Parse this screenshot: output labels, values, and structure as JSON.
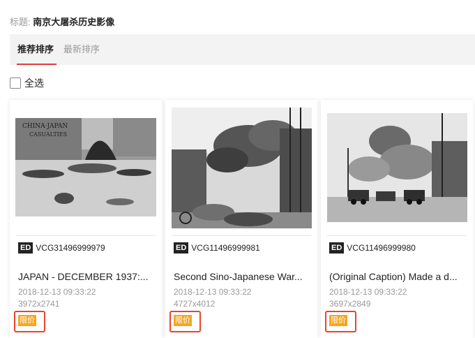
{
  "header": {
    "title_prefix": "标题:",
    "title": "南京大屠杀历史影像"
  },
  "tabs": [
    {
      "label": "推荐排序",
      "active": true
    },
    {
      "label": "最新排序",
      "active": false
    }
  ],
  "select_all": {
    "label": "全选",
    "checked": false
  },
  "colors": {
    "accent_red": "#e4393c",
    "price_orange": "#f5a623",
    "highlight_red": "#e8452c"
  },
  "cards": [
    {
      "badge": "ED",
      "id": "VCG31496999979",
      "caption": "JAPAN - DECEMBER 1937:...",
      "date": "2018-12-13 09:33:22",
      "dims": "3972x2741",
      "price_label": "限价"
    },
    {
      "badge": "ED",
      "id": "VCG11496999981",
      "caption": "Second Sino-Japanese War...",
      "date": "2018-12-13 09:33:22",
      "dims": "4727x4012",
      "price_label": "限价"
    },
    {
      "badge": "ED",
      "id": "VCG11496999980",
      "caption": "(Original Caption) Made a d...",
      "date": "2018-12-13 09:33:22",
      "dims": "3697x2849",
      "price_label": "限价"
    }
  ]
}
